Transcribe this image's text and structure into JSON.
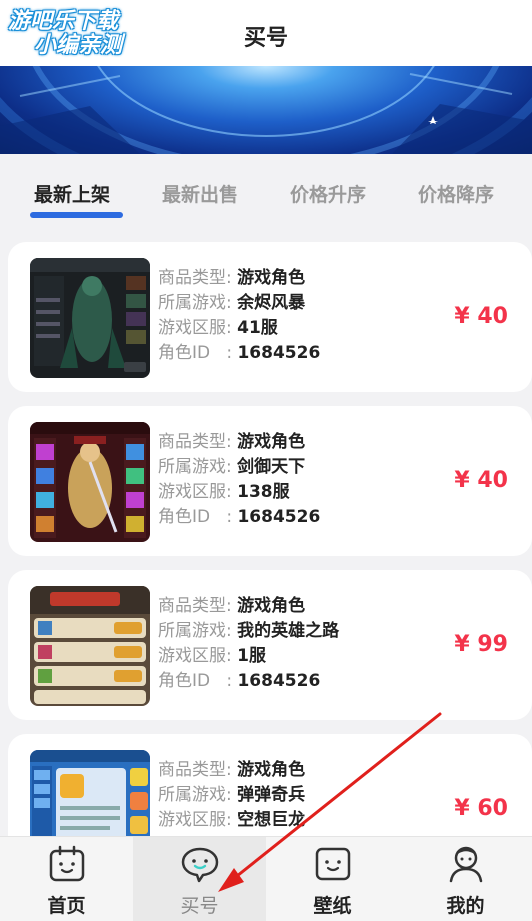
{
  "watermark": {
    "line1": "游吧乐下载",
    "line2": "小编亲测"
  },
  "header": {
    "title": "买号"
  },
  "tabs": [
    {
      "label": "最新上架",
      "active": true
    },
    {
      "label": "最新出售",
      "active": false
    },
    {
      "label": "价格升序",
      "active": false
    },
    {
      "label": "价格降序",
      "active": false
    }
  ],
  "listing_labels": {
    "type": "商品类型",
    "game": "所属游戏",
    "server": "游戏区服",
    "role_id": "角色ID",
    "colon": ":"
  },
  "listings": [
    {
      "type": "游戏角色",
      "game": "余烬风暴",
      "server": "41服",
      "role_id": "1684526",
      "price": "¥ 40",
      "thumb": "dark-warrior-game-screenshot"
    },
    {
      "type": "游戏角色",
      "game": "剑御天下",
      "server": "138服",
      "role_id": "1684526",
      "price": "¥ 40",
      "thumb": "sword-hero-game-screenshot"
    },
    {
      "type": "游戏角色",
      "game": "我的英雄之路",
      "server": "1服",
      "role_id": "1684526",
      "price": "¥ 99",
      "thumb": "hero-list-game-screenshot"
    },
    {
      "type": "游戏角色",
      "game": "弹弹奇兵",
      "server": "空想巨龙",
      "role_id": "",
      "price": "¥ 60",
      "thumb": "blue-ui-game-screenshot"
    }
  ],
  "nav": [
    {
      "label": "首页",
      "icon": "home-face-icon",
      "active": false
    },
    {
      "label": "买号",
      "icon": "chat-face-icon",
      "active": true
    },
    {
      "label": "壁纸",
      "icon": "tv-face-icon",
      "active": false
    },
    {
      "label": "我的",
      "icon": "person-icon",
      "active": false
    }
  ],
  "colors": {
    "accent": "#2d6be0",
    "price": "#f3334a",
    "annotation_arrow": "#e0201c"
  }
}
